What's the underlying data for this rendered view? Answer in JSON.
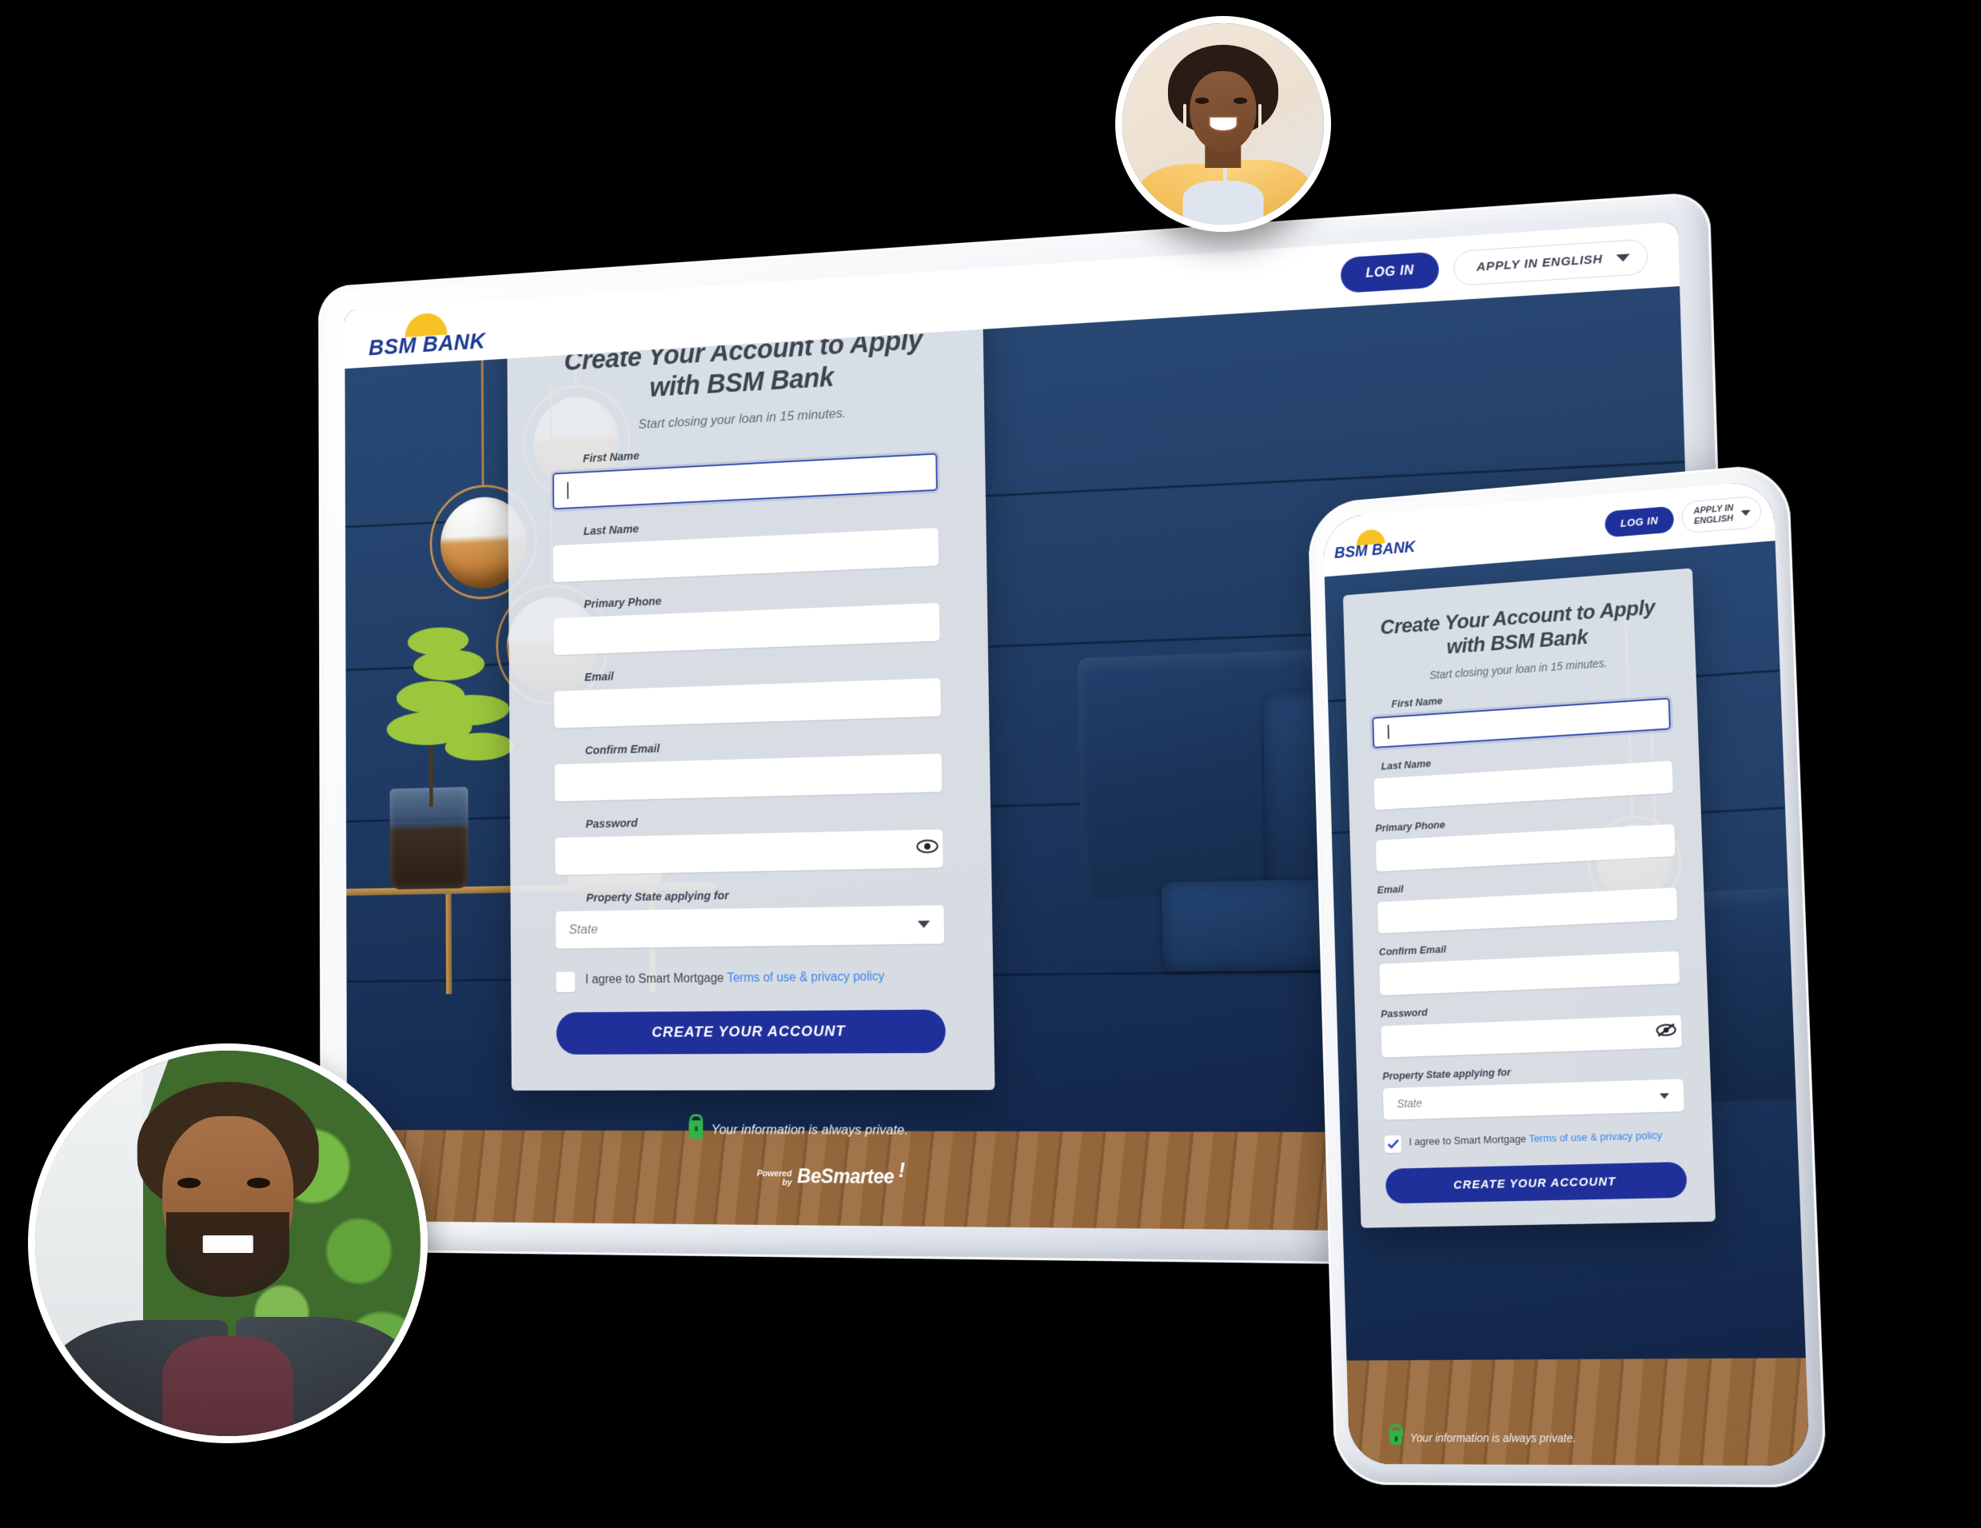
{
  "header": {
    "brand_name": "BSM BANK",
    "login_label": "LOG IN",
    "language_label": "APPLY IN ENGLISH",
    "language_label_mobile_l1": "APPLY IN",
    "language_label_mobile_l2": "ENGLISH"
  },
  "form": {
    "title": "Create Your Account to Apply with BSM Bank",
    "title_mobile": "Create Your Account to Apply with BSM Bank",
    "subtitle": "Start closing your loan in 15 minutes.",
    "fields": [
      {
        "label": "First Name",
        "value": "",
        "placeholder": "",
        "focused": true
      },
      {
        "label": "Last Name",
        "value": "",
        "placeholder": "",
        "focused": false
      },
      {
        "label": "Primary Phone",
        "value": "",
        "placeholder": "",
        "focused": false
      },
      {
        "label": "Email",
        "value": "",
        "placeholder": "",
        "focused": false
      },
      {
        "label": "Confirm Email",
        "value": "",
        "placeholder": "",
        "focused": false
      },
      {
        "label": "Password",
        "value": "",
        "placeholder": "",
        "focused": false
      }
    ],
    "state_label": "Property State applying for",
    "state_value": "State",
    "agree_text": "I agree to Smart Mortgage ",
    "agree_link": "Terms of use & privacy policy",
    "agree_checked_tablet": false,
    "agree_checked_mobile": true,
    "submit_label": "CREATE YOUR ACCOUNT",
    "password_icon_tablet": "eye-icon",
    "password_icon_mobile": "eye-off-icon"
  },
  "footer": {
    "privacy_text": "Your information is always private.",
    "powered_small_1": "Powered",
    "powered_small_2": "by",
    "powered_brand": "BeSmartee",
    "powered_bang": "!"
  },
  "colors": {
    "brand_navy": "#1e3a93",
    "button_blue": "#20309b",
    "brand_yellow": "#f7c324",
    "link_blue": "#3c86e8",
    "lock_green": "#2fb34a",
    "wall_navy": "#1b3a66"
  },
  "avatars": [
    {
      "name": "smiling-woman-yellow-blazer"
    },
    {
      "name": "smiling-man-dark-coat"
    }
  ]
}
